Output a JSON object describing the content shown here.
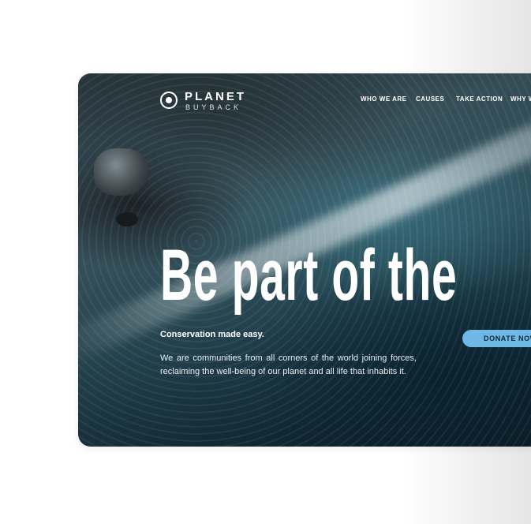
{
  "site": {
    "logo": {
      "name": "PLANET",
      "sub": "BUYBACK",
      "icon": "planet-logo-icon"
    },
    "nav": [
      {
        "label": "WHO WE ARE"
      },
      {
        "label": "CAUSES"
      },
      {
        "label": "TAKE ACTION"
      },
      {
        "label": "WHY W"
      }
    ]
  },
  "hero": {
    "headline": "Be part of the",
    "tagline": "Conservation made easy.",
    "description": "We are communities from all corners of the world joining forces, reclaiming the well-being of our planet and all life that inhabits it.",
    "cta_label": "DONATE NOW",
    "background": "aerial ocean waves crashing on rocky shore"
  },
  "colors": {
    "accent": "#6fb8e6",
    "text": "#ffffff",
    "ocean_dark": "#153444"
  }
}
